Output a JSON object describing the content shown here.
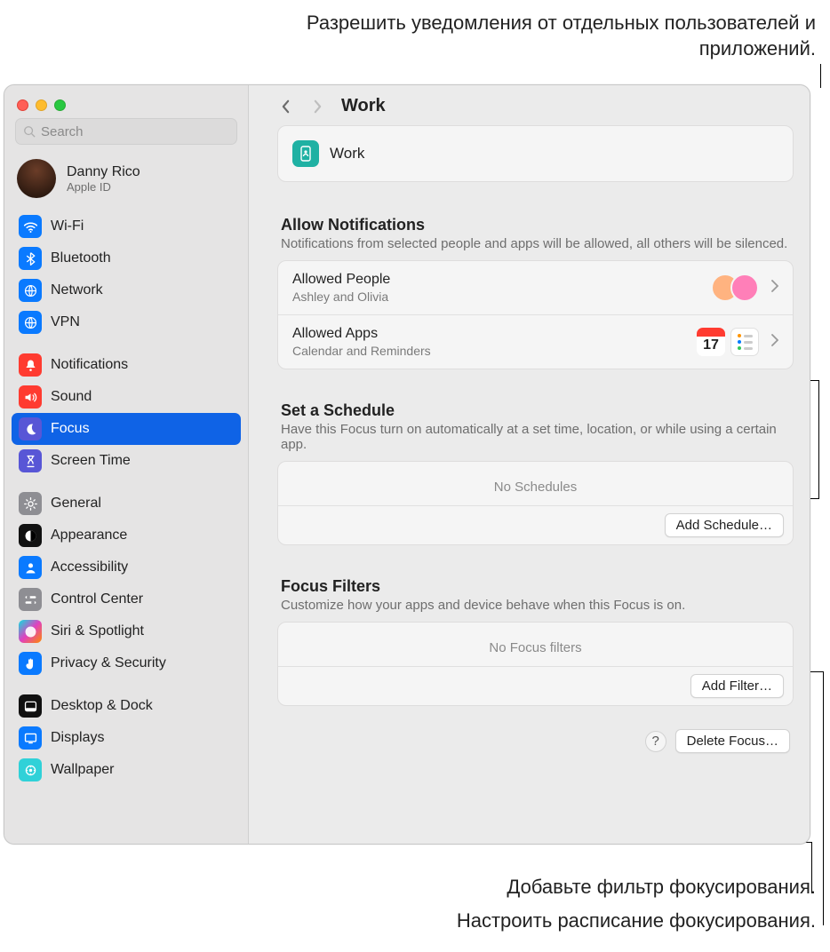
{
  "annotations": {
    "top": "Разрешить уведомления от отдельных пользователей и приложений.",
    "bottom1": "Добавьте фильтр фокусирования.",
    "bottom2": "Настроить расписание фокусирования."
  },
  "search": {
    "placeholder": "Search"
  },
  "profile": {
    "name": "Danny Rico",
    "subtitle": "Apple ID"
  },
  "sidebar": {
    "groups": [
      {
        "items": [
          {
            "label": "Wi-Fi",
            "icon": "wifi",
            "color": "ic-blue"
          },
          {
            "label": "Bluetooth",
            "icon": "bluetooth",
            "color": "ic-blue"
          },
          {
            "label": "Network",
            "icon": "globe",
            "color": "ic-blue"
          },
          {
            "label": "VPN",
            "icon": "globe",
            "color": "ic-blue"
          }
        ]
      },
      {
        "items": [
          {
            "label": "Notifications",
            "icon": "bell",
            "color": "ic-red"
          },
          {
            "label": "Sound",
            "icon": "speaker",
            "color": "ic-red"
          },
          {
            "label": "Focus",
            "icon": "moon",
            "color": "ic-indigo",
            "active": true
          },
          {
            "label": "Screen Time",
            "icon": "hourglass",
            "color": "ic-indigo"
          }
        ]
      },
      {
        "items": [
          {
            "label": "General",
            "icon": "gear",
            "color": "ic-gray"
          },
          {
            "label": "Appearance",
            "icon": "appearance",
            "color": "ic-black"
          },
          {
            "label": "Accessibility",
            "icon": "person",
            "color": "ic-blue"
          },
          {
            "label": "Control Center",
            "icon": "switches",
            "color": "ic-gray"
          },
          {
            "label": "Siri & Spotlight",
            "icon": "siri",
            "color": "ic-siri"
          },
          {
            "label": "Privacy & Security",
            "icon": "hand",
            "color": "ic-blue"
          }
        ]
      },
      {
        "items": [
          {
            "label": "Desktop & Dock",
            "icon": "dock",
            "color": "ic-black"
          },
          {
            "label": "Displays",
            "icon": "display",
            "color": "ic-blue"
          },
          {
            "label": "Wallpaper",
            "icon": "wallpaper",
            "color": "ic-cyan"
          }
        ]
      }
    ]
  },
  "breadcrumb": {
    "title": "Work"
  },
  "focus": {
    "header_label": "Work",
    "allow": {
      "title": "Allow Notifications",
      "subtitle": "Notifications from selected people and apps will be allowed, all others will be silenced.",
      "people": {
        "title": "Allowed People",
        "subtitle": "Ashley and Olivia"
      },
      "apps": {
        "title": "Allowed Apps",
        "subtitle": "Calendar and Reminders",
        "cal_day": "17"
      }
    },
    "schedule": {
      "title": "Set a Schedule",
      "subtitle": "Have this Focus turn on automatically at a set time, location, or while using a certain app.",
      "empty": "No Schedules",
      "button": "Add Schedule…"
    },
    "filters": {
      "title": "Focus Filters",
      "subtitle": "Customize how your apps and device behave when this Focus is on.",
      "empty": "No Focus filters",
      "button": "Add Filter…"
    },
    "footer": {
      "help": "?",
      "delete": "Delete Focus…"
    }
  }
}
